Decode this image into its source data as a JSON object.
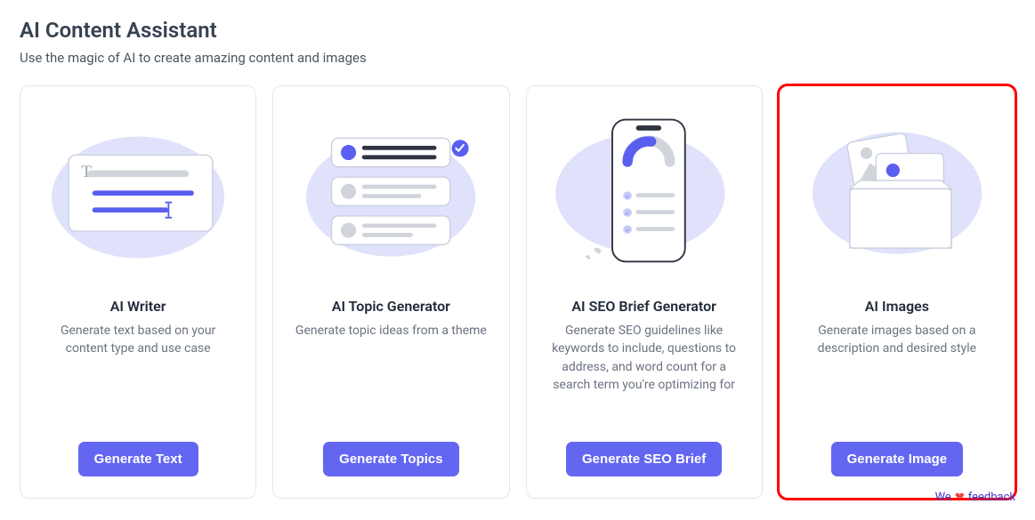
{
  "header": {
    "title": "AI Content Assistant",
    "subtitle": "Use the magic of AI to create amazing content and images"
  },
  "cards": [
    {
      "id": "ai-writer",
      "title": "AI Writer",
      "description": "Generate text based on your content type and use case",
      "button_label": "Generate Text",
      "highlighted": false
    },
    {
      "id": "ai-topic-generator",
      "title": "AI Topic Generator",
      "description": "Generate topic ideas from a theme",
      "button_label": "Generate Topics",
      "highlighted": false
    },
    {
      "id": "ai-seo-brief-generator",
      "title": "AI SEO Brief Generator",
      "description": "Generate SEO guidelines like keywords to include, questions to address, and word count for a search term you're optimizing for",
      "button_label": "Generate SEO Brief",
      "highlighted": false
    },
    {
      "id": "ai-images",
      "title": "AI Images",
      "description": "Generate images based on a description and desired style",
      "button_label": "Generate Image",
      "highlighted": true
    }
  ],
  "feedback": {
    "prefix": "We",
    "heart": "❤",
    "suffix": "feedback"
  },
  "colors": {
    "accent": "#6366f1",
    "highlight_border": "#ff0000",
    "blob": "#e0e2fb",
    "text_muted": "#6b7280"
  }
}
